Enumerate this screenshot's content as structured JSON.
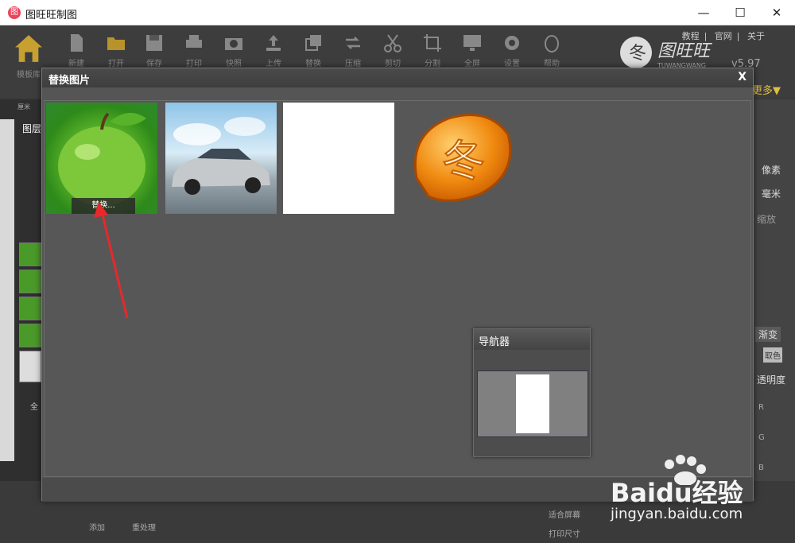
{
  "window": {
    "title": "图旺旺制图",
    "min": "—",
    "max": "☐",
    "close": "✕"
  },
  "toolbar": {
    "home_label": "模板库",
    "items": [
      "新建",
      "打开",
      "保存",
      "打印",
      "快照",
      "上传",
      "替换",
      "压缩",
      "剪切",
      "分割",
      "全屏",
      "设置",
      "帮助"
    ],
    "links": [
      "教程",
      "官网",
      "关于"
    ],
    "version": "v5.97",
    "more_label": "更多▼"
  },
  "left_panel": {
    "unit_label": "厘米",
    "layer_label": "图层",
    "all_label": "全"
  },
  "right_panel": {
    "pixel": "像素",
    "mm": "毫米",
    "zoom": "缩放",
    "gradient": "渐变",
    "pick": "取色",
    "opacity": "透明度",
    "r": "R",
    "g": "G",
    "b": "B"
  },
  "bottom": {
    "add": "添加",
    "process": "重处理",
    "fit_screen": "适合屏幕",
    "print_size": "打印尺寸"
  },
  "dialog": {
    "title": "替换图片",
    "close": "X",
    "replace_button": "替换..."
  },
  "navigator": {
    "title": "导航器"
  },
  "watermark": {
    "main": "Baidu经验",
    "sub": "jingyan.baidu.com"
  }
}
